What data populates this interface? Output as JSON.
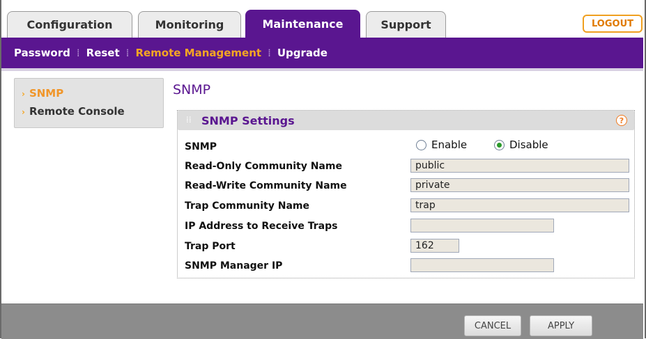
{
  "tabs": [
    {
      "label": "Configuration",
      "active": false
    },
    {
      "label": "Monitoring",
      "active": false
    },
    {
      "label": "Maintenance",
      "active": true
    },
    {
      "label": "Support",
      "active": false
    }
  ],
  "logout_label": "LOGOUT",
  "subnav": [
    "Password",
    "Reset",
    "Remote Management",
    "Upgrade"
  ],
  "subnav_active": "Remote Management",
  "leftmenu": [
    "SNMP",
    "Remote Console"
  ],
  "leftmenu_active": "SNMP",
  "page_title": "SNMP",
  "panel": {
    "title": "SNMP Settings",
    "help_symbol": "?",
    "snmp_label": "SNMP",
    "radio_enable": "Enable",
    "radio_disable": "Disable",
    "snmp_selected": "Disable",
    "fields": [
      {
        "label": "Read-Only Community Name",
        "value": ""
      },
      {
        "label": "Read-Write Community Name",
        "value": ""
      },
      {
        "label": "Trap Community Name",
        "value": ""
      },
      {
        "label": "IP Address to Receive Traps",
        "value": ""
      },
      {
        "label": "Trap Port",
        "value": ""
      },
      {
        "label": "SNMP Manager IP",
        "value": ""
      }
    ],
    "values": {
      "read_only": "public",
      "read_write": "private",
      "trap_community": "trap",
      "trap_ip": "",
      "trap_port": "162",
      "manager_ip": ""
    }
  },
  "buttons": {
    "cancel": "CANCEL",
    "apply": "APPLY"
  },
  "colors": {
    "brand_purple": "#5a1690",
    "accent_orange": "#f5a623",
    "footer_gray": "#8c8c8c"
  }
}
